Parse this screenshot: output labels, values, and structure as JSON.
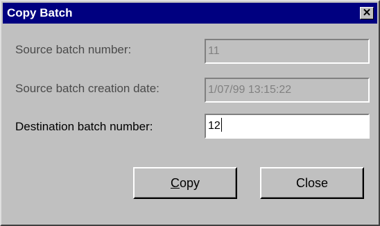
{
  "window": {
    "title": "Copy Batch",
    "close_glyph": "✕"
  },
  "fields": {
    "source_number": {
      "label": "Source batch number:",
      "value": "11"
    },
    "source_date": {
      "label": "Source batch creation date:",
      "value": "1/07/99 13:15:22"
    },
    "destination_number": {
      "label": "Destination batch number:",
      "value": "12"
    }
  },
  "buttons": {
    "copy": {
      "mnemonic": "C",
      "rest": "opy"
    },
    "close": {
      "label": "Close"
    }
  }
}
